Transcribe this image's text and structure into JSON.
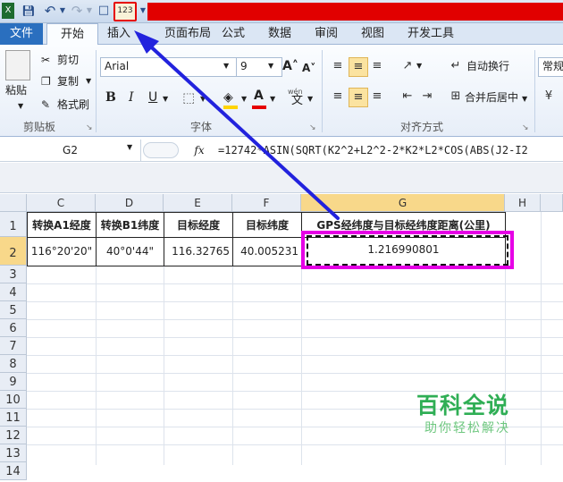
{
  "tabs": [
    "文件",
    "开始",
    "插入",
    "页面布局",
    "公式",
    "数据",
    "审阅",
    "视图",
    "开发工具"
  ],
  "clipboard": {
    "paste": "粘贴",
    "cut": "剪切",
    "copy": "复制",
    "format_painter": "格式刷",
    "group": "剪贴板"
  },
  "font": {
    "name": "Arial",
    "size": "9",
    "bold": "B",
    "italic": "I",
    "underline": "U",
    "phonetic": "wén",
    "group": "字体"
  },
  "alignment": {
    "wrap": "自动换行",
    "merge": "合并后居中",
    "group": "对齐方式"
  },
  "number": {
    "format": "常规"
  },
  "calc_icon_text": "123",
  "name_box": "G2",
  "formula": "=12742*ASIN(SQRT(K2^2+L2^2-2*K2*L2*COS(ABS(J2-I2",
  "fx": "fx",
  "columns": [
    "C",
    "D",
    "E",
    "F",
    "G",
    "H"
  ],
  "rows": [
    "1",
    "2",
    "3",
    "4",
    "5",
    "6",
    "7",
    "8",
    "9",
    "10",
    "11",
    "12",
    "13",
    "14"
  ],
  "table": {
    "headers": [
      "转换A1经度",
      "转换B1纬度",
      "目标经度",
      "目标纬度",
      "GPS经纬度与目标经纬度距离(公里)"
    ],
    "values": [
      "116°20'20\"",
      "40°0'44\"",
      "116.32765",
      "40.005231",
      "1.216990801"
    ]
  },
  "watermark": {
    "title": "百科全说",
    "subtitle": "助你轻松解决"
  },
  "colors": {
    "highlight": "#e600e6",
    "arrow": "#2222dd",
    "accent_red": "#e10000"
  }
}
